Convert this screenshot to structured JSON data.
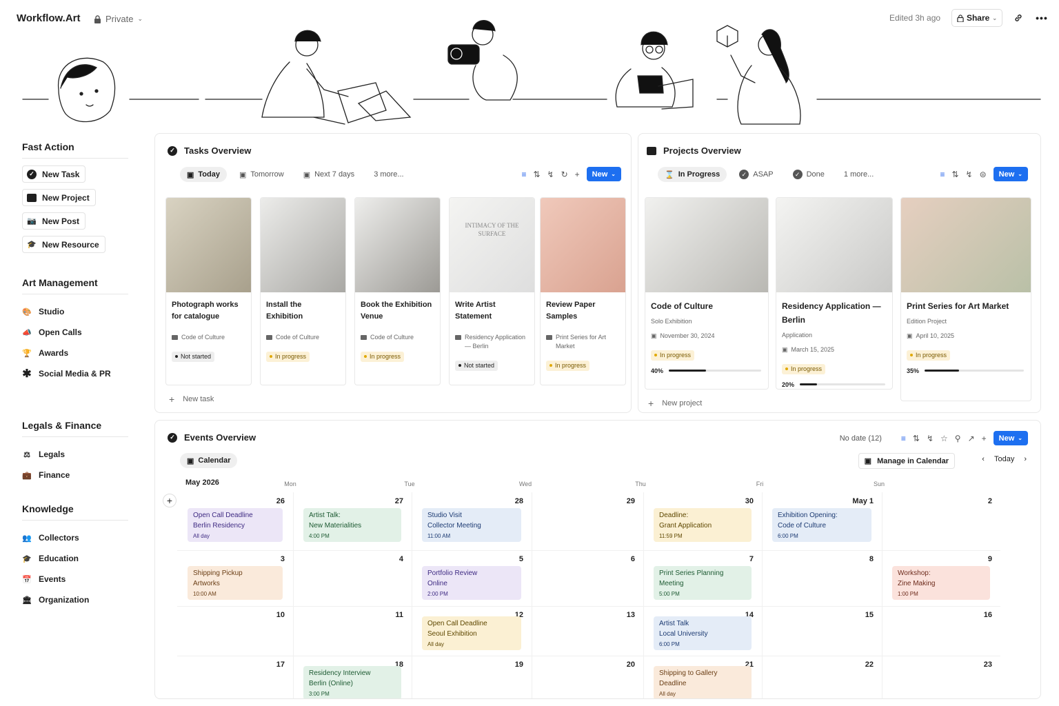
{
  "topbar": {
    "brand": "Workflow.Art",
    "privacy": "Private",
    "edited": "Edited 3h ago",
    "share": "Share",
    "icons": [
      "lock-icon",
      "chevron-down-icon",
      "link-icon",
      "more-icon"
    ]
  },
  "sidebar": {
    "fast_action": {
      "heading": "Fast Action",
      "items": [
        {
          "label": "New Task",
          "icon": "check-circle-icon"
        },
        {
          "label": "New Project",
          "icon": "folder-icon"
        },
        {
          "label": "New Post",
          "icon": "camera-icon"
        },
        {
          "label": "New Resource",
          "icon": "graduation-cap-icon"
        }
      ]
    },
    "art_management": {
      "heading": "Art Management",
      "items": [
        {
          "label": "Studio",
          "icon": "palette-icon"
        },
        {
          "label": "Open Calls",
          "icon": "megaphone-icon"
        },
        {
          "label": "Awards",
          "icon": "trophy-icon"
        },
        {
          "label": "Social Media & PR",
          "icon": "asterisk-icon"
        }
      ]
    },
    "legals_finance": {
      "heading": "Legals & Finance",
      "items": [
        {
          "label": "Legals",
          "icon": "scales-icon"
        },
        {
          "label": "Finance",
          "icon": "wallet-icon"
        }
      ]
    },
    "knowledge": {
      "heading": "Knowledge",
      "items": [
        {
          "label": "Collectors",
          "icon": "users-icon"
        },
        {
          "label": "Education",
          "icon": "graduation-cap-icon"
        },
        {
          "label": "Events",
          "icon": "calendar-icon"
        },
        {
          "label": "Organization",
          "icon": "building-icon"
        }
      ]
    }
  },
  "tasks": {
    "title": "Tasks Overview",
    "tabs": [
      {
        "label": "Today",
        "active": true
      },
      {
        "label": "Tomorrow"
      },
      {
        "label": "Next 7 days"
      },
      {
        "label": "3 more..."
      }
    ],
    "new": "New",
    "add": "New task",
    "cards": [
      {
        "title": "Photograph works for catalogue",
        "project": "Code of Culture",
        "status": "Not started",
        "colors": [
          "#d9d3c2",
          "#a8a08c"
        ]
      },
      {
        "title": "Install the Exhibition",
        "project": "Code of Culture",
        "status": "In progress",
        "colors": [
          "#ececea",
          "#a9a8a4"
        ]
      },
      {
        "title": "Book the Exhibition Venue",
        "project": "Code of Culture",
        "status": "In progress",
        "colors": [
          "#eeeeec",
          "#9c9a95"
        ]
      },
      {
        "title": "Write Artist Statement",
        "project": "Residency Application — Berlin",
        "status": "Not started",
        "colors": [
          "#f4f4f2",
          "#dedede"
        ],
        "image_text": "INTIMACY OF THE SURFACE"
      },
      {
        "title": "Review Paper Samples",
        "project": "Print Series for Art Market",
        "status": "In progress",
        "colors": [
          "#f0c9bb",
          "#d9a290"
        ]
      }
    ]
  },
  "projects": {
    "title": "Projects Overview",
    "tabs": [
      {
        "label": "In Progress",
        "active": true
      },
      {
        "label": "ASAP"
      },
      {
        "label": "Done"
      },
      {
        "label": "1 more..."
      }
    ],
    "new": "New",
    "add": "New project",
    "cards": [
      {
        "title": "Code of Culture",
        "type": "Solo Exhibition",
        "date": "November 30, 2024",
        "status": "In progress",
        "progress_label": "40%",
        "progress": 0.4,
        "colors": [
          "#f1f1ef",
          "#b9b8b3"
        ]
      },
      {
        "title": "Residency Application — Berlin",
        "type": "Application",
        "date": "March 15, 2025",
        "status": "In progress",
        "progress_label": "20%",
        "progress": 0.2,
        "colors": [
          "#f4f4f2",
          "#c9c9c7"
        ]
      },
      {
        "title": "Print Series for Art Market",
        "type": "Edition Project",
        "date": "April 10, 2025",
        "status": "In progress",
        "progress_label": "35%",
        "progress": 0.35,
        "colors": [
          "#e6cfc0",
          "#b9c0a7"
        ]
      }
    ]
  },
  "events": {
    "title": "Events Overview",
    "no_date": "No date (12)",
    "new": "New",
    "view_tab": "Calendar",
    "manage": "Manage in Calendar",
    "today": "Today",
    "month": "May 2026",
    "weekdays": [
      "Mon",
      "Tue",
      "Wed",
      "Thu",
      "Fri",
      "Sun"
    ],
    "weeks": [
      [
        "26",
        "27",
        "28",
        "29",
        "30",
        "May 1",
        "2"
      ],
      [
        "3",
        "4",
        "5",
        "6",
        "7",
        "8",
        "9"
      ],
      [
        "10",
        "11",
        "12",
        "13",
        "14",
        "15",
        "16"
      ],
      [
        "17",
        "18",
        "19",
        "20",
        "21",
        "22",
        "23"
      ]
    ],
    "items": [
      {
        "week": 0,
        "col": 0,
        "l1": "Open Call Deadline",
        "l2": "Berlin Residency",
        "time": "All day",
        "color": "purple"
      },
      {
        "week": 0,
        "col": 1,
        "l1": "Artist Talk:",
        "l2": "New Materialities",
        "time": "4:00 PM",
        "color": "green"
      },
      {
        "week": 0,
        "col": 2,
        "l1": "Studio Visit",
        "l2": "Collector Meeting",
        "time": "11:00 AM",
        "color": "blue"
      },
      {
        "week": 0,
        "col": 4,
        "l1": "Deadline:",
        "l2": "Grant Application",
        "time": "11:59 PM",
        "color": "yellow"
      },
      {
        "week": 0,
        "col": 5,
        "l1": "Exhibition Opening:",
        "l2": "Code of Culture",
        "time": "6:00 PM",
        "color": "blue"
      },
      {
        "week": 1,
        "col": 0,
        "l1": "Shipping Pickup",
        "l2": "Artworks",
        "time": "10:00 AM",
        "color": "orange"
      },
      {
        "week": 1,
        "col": 2,
        "l1": "Portfolio Review",
        "l2": "Online",
        "time": "2:00 PM",
        "color": "purple"
      },
      {
        "week": 1,
        "col": 4,
        "l1": "Print Series Planning",
        "l2": "Meeting",
        "time": "5:00 PM",
        "color": "green"
      },
      {
        "week": 1,
        "col": 6,
        "l1": "Workshop:",
        "l2": "Zine Making",
        "time": "1:00 PM",
        "color": "red"
      },
      {
        "week": 2,
        "col": 2,
        "l1": "Open Call Deadline",
        "l2": "Seoul Exhibition",
        "time": "All day",
        "color": "yellow"
      },
      {
        "week": 2,
        "col": 4,
        "l1": "Artist Talk",
        "l2": "Local University",
        "time": "6:00 PM",
        "color": "blue"
      },
      {
        "week": 3,
        "col": 1,
        "l1": "Residency Interview",
        "l2": "Berlin (Online)",
        "time": "3:00 PM",
        "color": "green"
      },
      {
        "week": 3,
        "col": 4,
        "l1": "Shipping to Gallery",
        "l2": "Deadline",
        "time": "All day",
        "color": "orange"
      }
    ]
  }
}
